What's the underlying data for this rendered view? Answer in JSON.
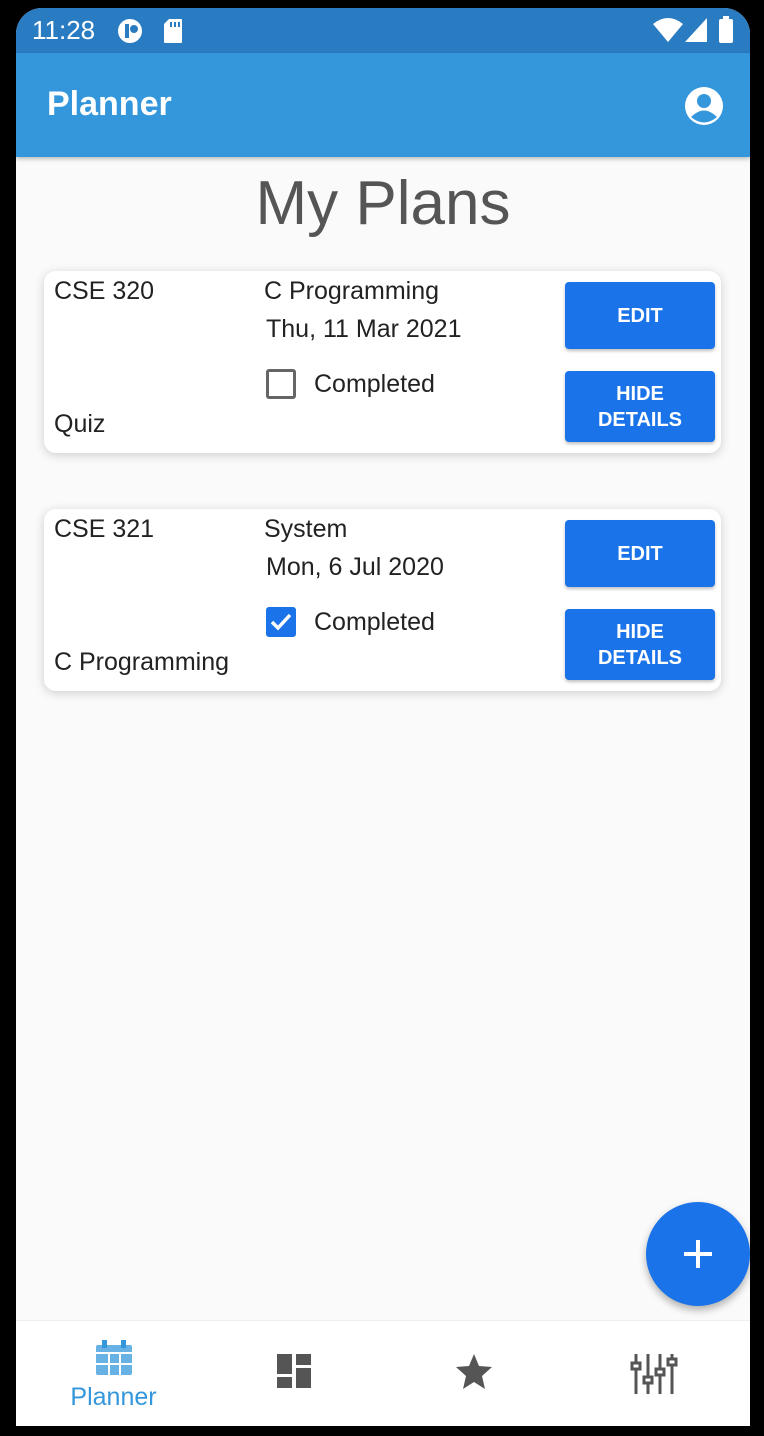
{
  "status_bar": {
    "time": "11:28"
  },
  "app_bar": {
    "title": "Planner",
    "account_icon": "account-circle-icon"
  },
  "page": {
    "title": "My Plans"
  },
  "plans": [
    {
      "course": "CSE 320",
      "topic": "C Programming",
      "date": "Thu, 11 Mar 2021",
      "completed": false,
      "completed_label": "Completed",
      "type": "Quiz",
      "edit_label": "EDIT",
      "hide_label": "HIDE\nDETAILS"
    },
    {
      "course": "CSE 321",
      "topic": "System",
      "date": "Mon, 6 Jul 2020",
      "completed": true,
      "completed_label": "Completed",
      "type": "C Programming",
      "edit_label": "EDIT",
      "hide_label": "HIDE\nDETAILS"
    }
  ],
  "fab": {
    "icon": "plus-icon"
  },
  "bottom_nav": {
    "items": [
      {
        "label": "Planner",
        "icon": "calendar-icon",
        "active": true
      },
      {
        "label": "",
        "icon": "dashboard-icon",
        "active": false
      },
      {
        "label": "",
        "icon": "star-icon",
        "active": false
      },
      {
        "label": "",
        "icon": "sliders-icon",
        "active": false
      }
    ]
  },
  "colors": {
    "status_bar": "#2a7cc2",
    "app_bar": "#3497db",
    "primary_button": "#1a73e8",
    "active_nav": "#3497db",
    "inactive_nav": "#555555",
    "background": "#fafafa"
  }
}
